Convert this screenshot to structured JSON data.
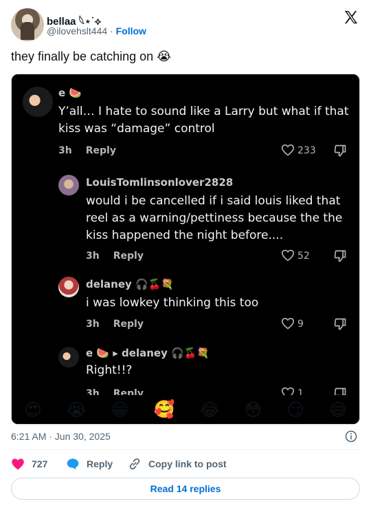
{
  "author": {
    "display_name": "bellaa 𓆩⋆˙⟡",
    "handle": "@ilovehslt444",
    "separator": "·",
    "follow_label": "Follow"
  },
  "tweet": {
    "text": "they finally be catching on",
    "emoji": "😭"
  },
  "media": {
    "comments": [
      {
        "user": "e 🍉",
        "text": "Y’all… I hate to sound like a Larry but what if that kiss was “damage” control",
        "time": "3h",
        "reply_label": "Reply",
        "likes": "233"
      },
      {
        "user": "LouisTomlinsonlover2828",
        "text": "would i be cancelled if i said louis liked that reel as a warning/pettiness because the the kiss happened the night before....",
        "time": "3h",
        "reply_label": "Reply",
        "likes": "52"
      },
      {
        "user": "delaney 🎧🍒💐",
        "text": "i was lowkey thinking this too",
        "time": "3h",
        "reply_label": "Reply",
        "likes": "9"
      },
      {
        "user": "e 🍉 ▸ delaney 🎧🍒💐",
        "text": "Right!!?",
        "time": "3h",
        "reply_label": "Reply",
        "likes": "1"
      }
    ],
    "emoji_bar": [
      "😍",
      "😭",
      "😁",
      "🥰",
      "😂",
      "😳",
      "😏",
      "😅"
    ]
  },
  "footer": {
    "timestamp": "6:21 AM · Jun 30, 2025",
    "like_count": "727",
    "reply_label": "Reply",
    "copy_label": "Copy link to post",
    "read_replies_label": "Read 14 replies"
  },
  "colors": {
    "link": "#006fd6",
    "heart": "#f91880",
    "reply_bubble": "#1d9bf0",
    "media_bg": "#000000"
  }
}
